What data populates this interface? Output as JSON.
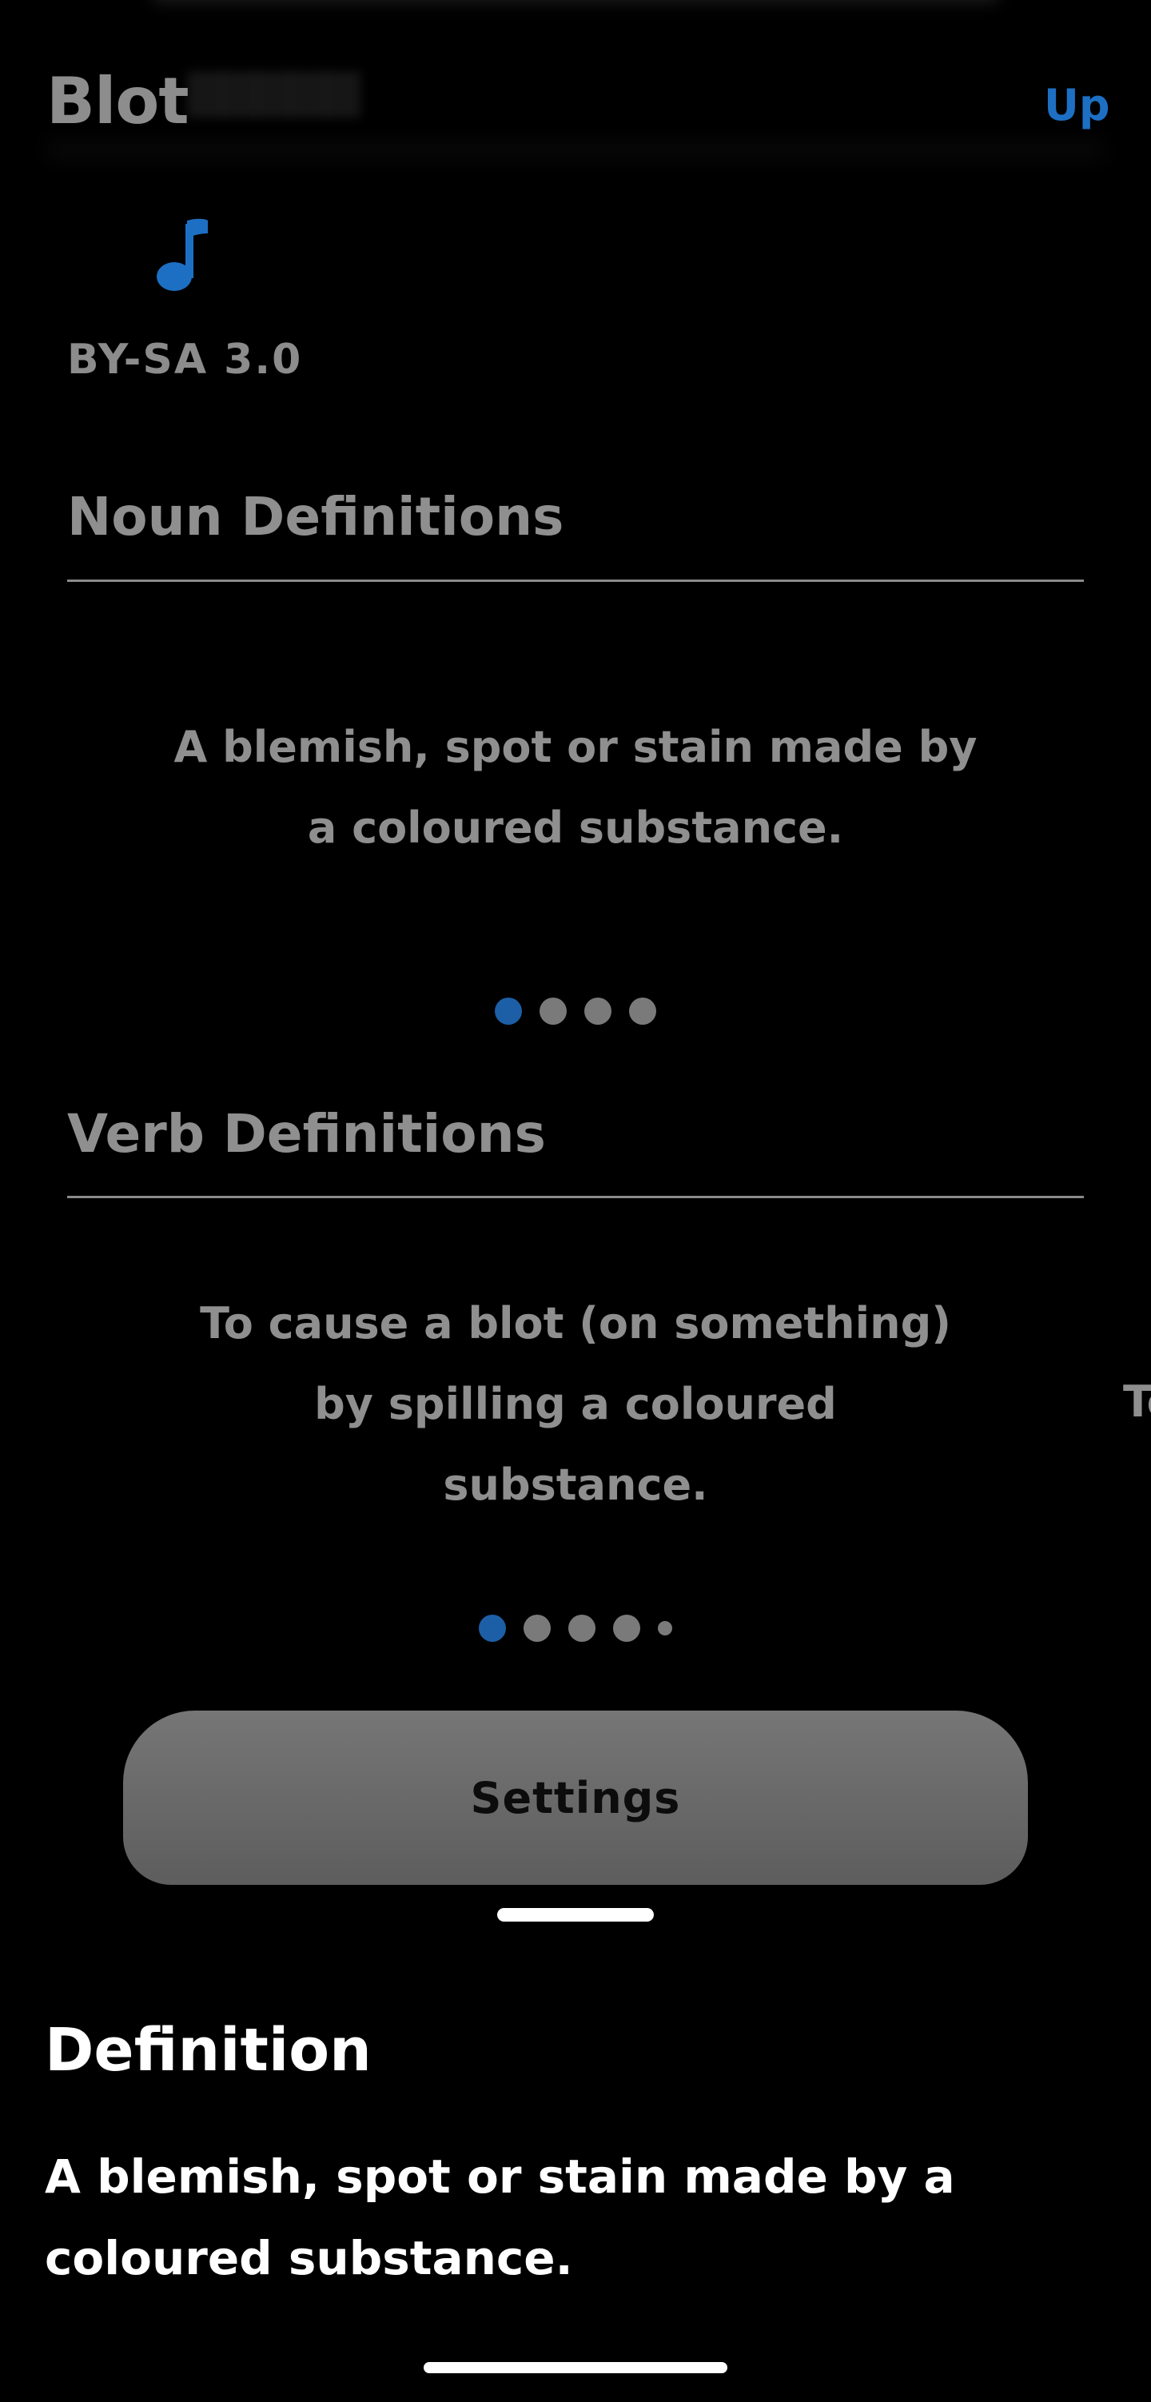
{
  "header": {
    "title": "Blot",
    "up_label": "Up"
  },
  "audio": {
    "icon": "music-note-icon"
  },
  "license": "BY-SA 3.0",
  "noun_section": {
    "title": "Noun Definitions",
    "definition": "A blemish, spot or stain made by a coloured substance.",
    "pager": {
      "count": 4,
      "active_index": 0
    }
  },
  "verb_section": {
    "title": "Verb Definitions",
    "definition": "To cause a blot (on something) by spilling a coloured substance.",
    "next_peek": "To",
    "pager": {
      "count": 5,
      "active_index": 0
    }
  },
  "settings_button": {
    "label": "Settings"
  },
  "definition_popup": {
    "title": "Definition",
    "body": "A blemish, spot or stain made by a coloured substance."
  },
  "colors": {
    "background": "#000000",
    "accent": "#1d6fc4",
    "text": "#8f8f8f",
    "popup_text": "#ffffff",
    "button": "#6a6a6a"
  }
}
